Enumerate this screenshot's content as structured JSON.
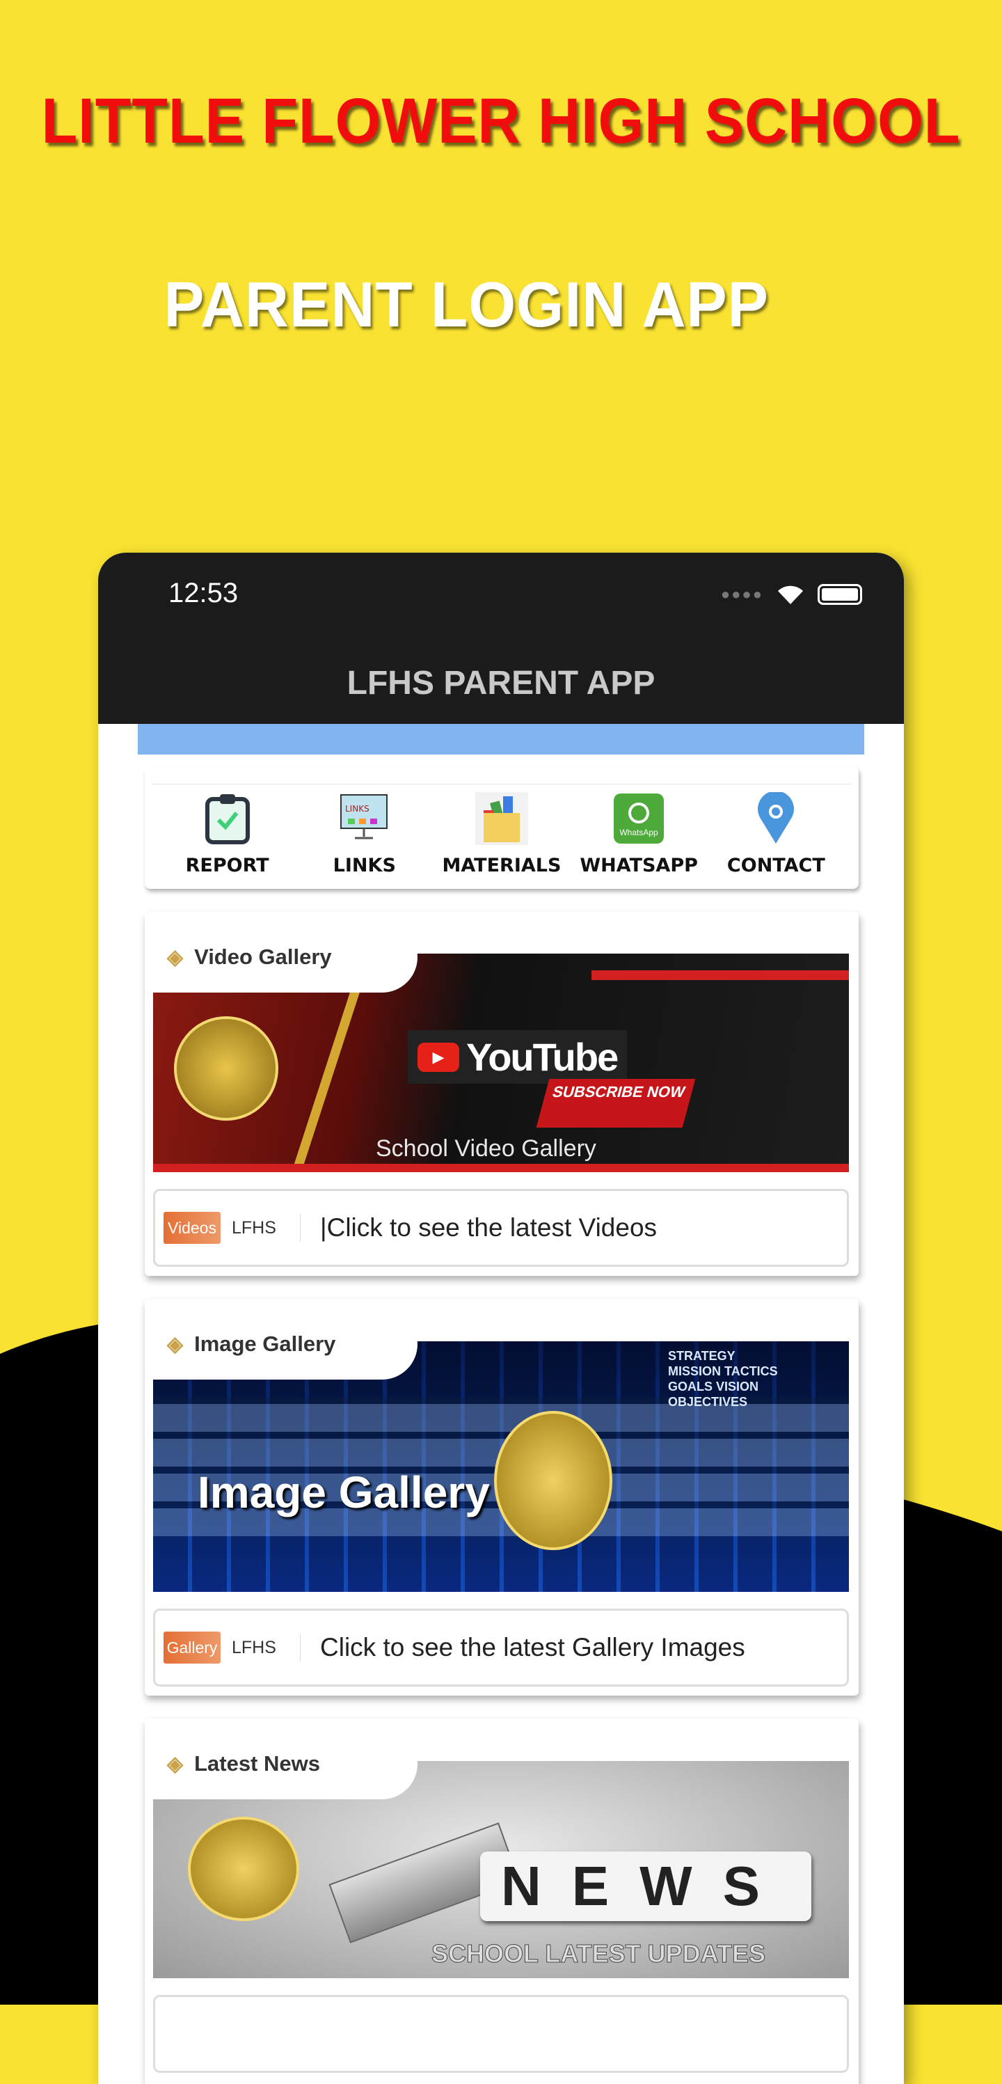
{
  "promo": {
    "title": "LITTLE FLOWER HIGH SCHOOL",
    "subtitle": "PARENT LOGIN APP",
    "bg_color": "#f9e231",
    "title_color": "#f20d0d"
  },
  "status_bar": {
    "time": "12:53",
    "icons": [
      "signal-dots-icon",
      "wifi-icon",
      "battery-icon"
    ]
  },
  "app": {
    "title": "LFHS PARENT APP"
  },
  "quick_links": [
    {
      "label": "REPORT",
      "icon": "clipboard-check-icon"
    },
    {
      "label": "LINKS",
      "icon": "useful-links-computer-icon"
    },
    {
      "label": "MATERIALS",
      "icon": "folder-materials-icon"
    },
    {
      "label": "WHATSAPP",
      "icon": "whatsapp-icon",
      "icon_text": "WhatsApp"
    },
    {
      "label": "CONTACT",
      "icon": "location-pin-icon"
    }
  ],
  "cards": [
    {
      "title": "Video Gallery",
      "banner": {
        "brand": "YouTube",
        "cta": "SUBSCRIBE NOW",
        "caption": "School Video Gallery"
      },
      "badge": "Videos",
      "source": "LFHS",
      "text": "|Click to see the latest Videos"
    },
    {
      "title": "Image Gallery",
      "banner": {
        "caption": "Image Gallery",
        "words": [
          "STRATEGY",
          "MISSION",
          "TACTICS",
          "VISION",
          "GOALS",
          "OBJECTIVES"
        ]
      },
      "badge": "Gallery",
      "source": "LFHS",
      "text": "Click to see the latest Gallery Images"
    },
    {
      "title": "Latest News",
      "banner": {
        "word": "NEWS",
        "caption": "SCHOOL LATEST UPDATES"
      }
    }
  ]
}
